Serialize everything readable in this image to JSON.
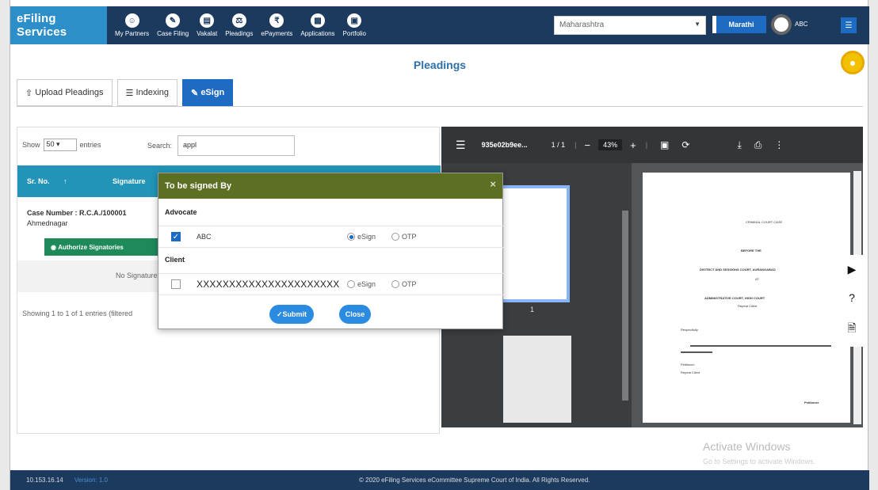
{
  "brand": "eFiling Services",
  "nav": [
    {
      "label": "My Partners",
      "icon": "user-icon"
    },
    {
      "label": "Case Filing",
      "icon": "pencil-icon"
    },
    {
      "label": "Vakalat",
      "icon": "document-icon"
    },
    {
      "label": "Pleadings",
      "icon": "scale-icon"
    },
    {
      "label": "ePayments",
      "icon": "rupee-icon"
    },
    {
      "label": "Applications",
      "icon": "file-icon"
    },
    {
      "label": "Portfolio",
      "icon": "briefcase-icon"
    }
  ],
  "header": {
    "state": "Maharashtra",
    "language": "Marathi",
    "user": "ABC"
  },
  "page_title": "Pleadings",
  "tabs": [
    {
      "label": "Upload Pleadings"
    },
    {
      "label": "Indexing"
    },
    {
      "label": "eSign"
    }
  ],
  "table": {
    "show_label": "Show",
    "entries_value": "50",
    "entries_label": "entries",
    "search_label": "Search:",
    "search_value": "appl",
    "col_sno": "Sr. No.",
    "col_sig": "Signature",
    "case_line1": "Case Number : R.C.A./100001",
    "case_line2": "Ahmednagar",
    "auth_button": "Authorize Signatories",
    "no_sig": "No Signature",
    "showing": "Showing 1 to 1 of 1 entries (filtered"
  },
  "modal": {
    "title": "To be signed By",
    "advocate_label": "Advocate",
    "advocate_name": "ABC",
    "client_label": "Client",
    "client_name": "XXXXXXXXXXXXXXXXXXXXXX",
    "esign_label": "eSign",
    "otp_label": "OTP",
    "submit": "Submit",
    "close": "Close"
  },
  "pdf": {
    "file_name": "935e02b9ee...",
    "pages": "1 / 1",
    "zoom": "43%",
    "thumb_num": "1"
  },
  "page_text": {
    "l1": "CRIMINAL COURT CASE",
    "l2": "BEFORE THE",
    "l3": "DISTRICT AND SESSIONS COURT, AURANGABAD",
    "l4": "AT",
    "l5": "ADMINISTRATIVE COURT, HIGH COURT",
    "l6": "Repeat Client",
    "l7": "Respectfully",
    "l8": "Petitioner:",
    "l9": "Repeat Client",
    "l10": "Petitioner"
  },
  "watermark": {
    "line1": "Activate Windows",
    "line2": "Go to Settings to activate Windows."
  },
  "footer": {
    "ip": "10.153.16.14",
    "version": "Version: 1.0",
    "copyright": "© 2020 eFiling Services eCommittee Supreme Court of India. All Rights Reserved."
  }
}
